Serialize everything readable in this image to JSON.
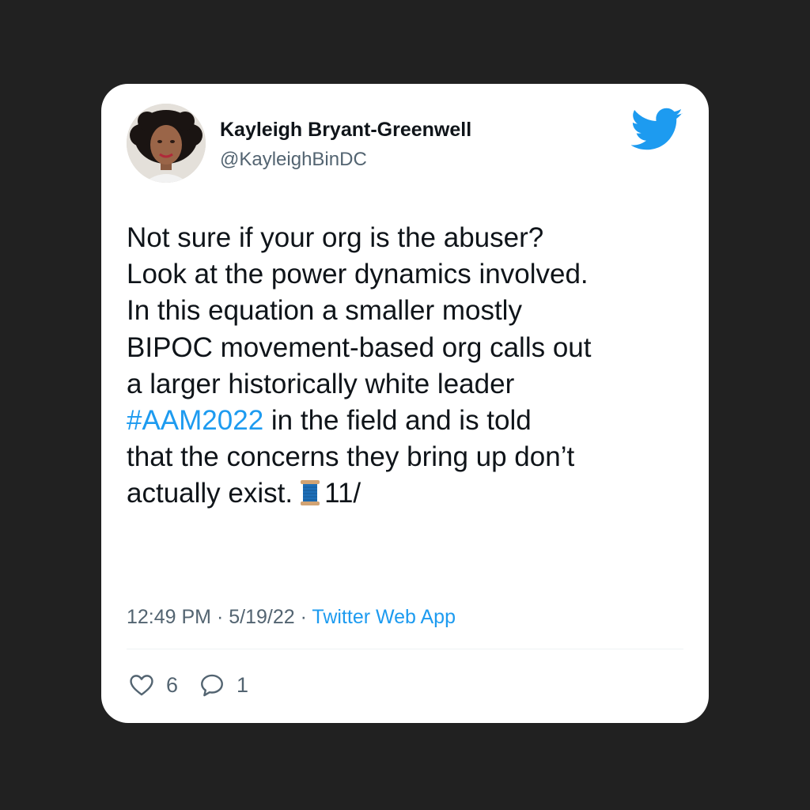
{
  "tweet": {
    "author_name": "Kayleigh Bryant-Greenwell",
    "author_handle": "@KayleighBinDC",
    "text_lines": [
      "Not sure if your org is the abuser?",
      "Look at the power dynamics involved.",
      "In this equation a smaller mostly",
      "BIPOC movement-based org calls out",
      "a larger historically white leader"
    ],
    "hashtag": "#AAM2022",
    "line_after_hashtag": " in the field and is told",
    "line_7": "that the concerns they bring up don’t",
    "line_8_start": "actually exist.",
    "thread_number": "11/",
    "time": "12:49 PM",
    "date": "5/19/22",
    "source": "Twitter Web App",
    "separator": " · ",
    "likes": "6",
    "replies": "1"
  },
  "icons": {
    "brand": "twitter-bird-icon",
    "like": "heart-icon",
    "reply": "reply-bubble-icon",
    "emoji": "spool-of-thread-icon"
  },
  "colors": {
    "background": "#212121",
    "card": "#ffffff",
    "twitter_blue": "#1d9bf0",
    "text": "#0f1419",
    "muted": "#536471"
  }
}
